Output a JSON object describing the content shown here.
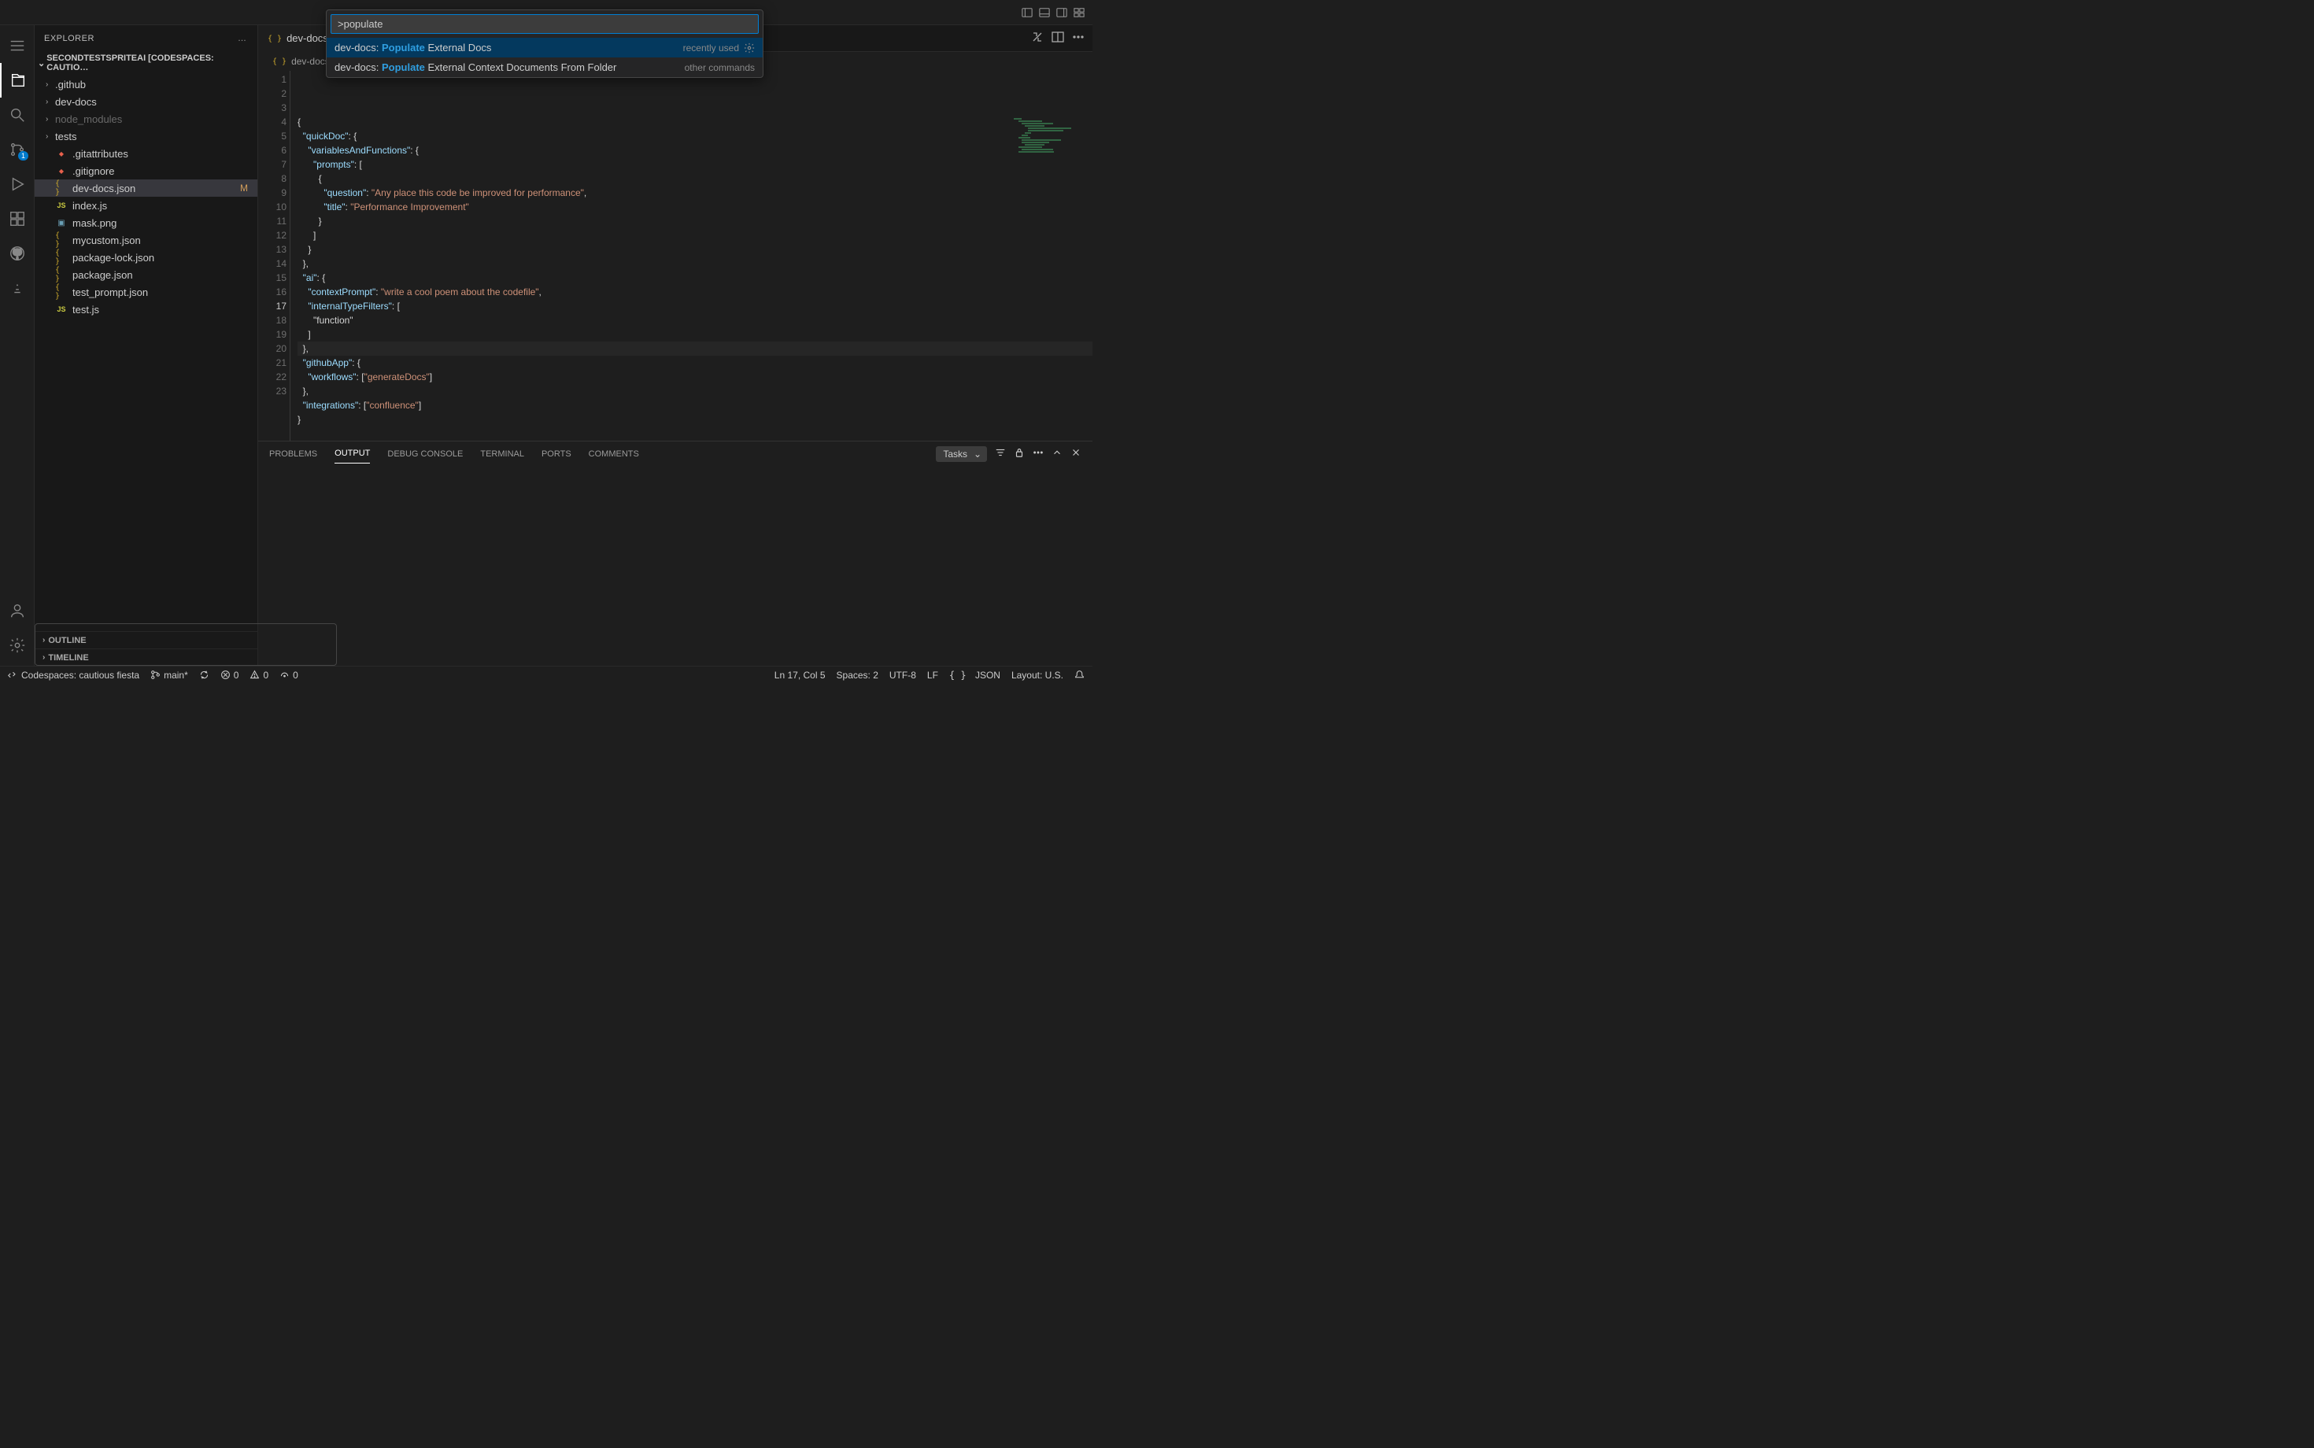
{
  "commandPalette": {
    "input": ">populate",
    "items": [
      {
        "prefix": "dev-docs: ",
        "highlight": "Populate",
        "suffix": " External Docs",
        "hint": "recently used",
        "gear": true
      },
      {
        "prefix": "dev-docs: ",
        "highlight": "Populate",
        "suffix": " External Context Documents From Folder",
        "hint": "other commands",
        "gear": false
      }
    ]
  },
  "sidebar": {
    "title": "EXPLORER",
    "actions": "…",
    "folderHeader": "SECONDTESTSPRITEAI [CODESPACES: CAUTIO…",
    "tree": [
      {
        "type": "folder",
        "label": ".github",
        "dim": false
      },
      {
        "type": "folder",
        "label": "dev-docs",
        "dim": false
      },
      {
        "type": "folder",
        "label": "node_modules",
        "dim": true
      },
      {
        "type": "folder",
        "label": "tests",
        "dim": false
      },
      {
        "type": "file",
        "icon": "git",
        "label": ".gitattributes"
      },
      {
        "type": "file",
        "icon": "git",
        "label": ".gitignore"
      },
      {
        "type": "file",
        "icon": "json",
        "label": "dev-docs.json",
        "selected": true,
        "badge": "M"
      },
      {
        "type": "file",
        "icon": "js",
        "label": "index.js"
      },
      {
        "type": "file",
        "icon": "img",
        "label": "mask.png"
      },
      {
        "type": "file",
        "icon": "json",
        "label": "mycustom.json"
      },
      {
        "type": "file",
        "icon": "json",
        "label": "package-lock.json"
      },
      {
        "type": "file",
        "icon": "json",
        "label": "package.json"
      },
      {
        "type": "file",
        "icon": "json",
        "label": "test_prompt.json"
      },
      {
        "type": "file",
        "icon": "js",
        "label": "test.js"
      }
    ],
    "outline": "OUTLINE",
    "timeline": "TIMELINE"
  },
  "activitybar": {
    "scmBadge": "1"
  },
  "tabs": {
    "tab1": "dev-docs.json",
    "breadcrumb": "dev-docs"
  },
  "editor": {
    "lines": [
      "{",
      "  \"quickDoc\": {",
      "    \"variablesAndFunctions\": {",
      "      \"prompts\": [",
      "        {",
      "          \"question\": \"Any place this code be improved for performance\",",
      "          \"title\": \"Performance Improvement\"",
      "        }",
      "      ]",
      "    }",
      "  },",
      "  \"ai\": {",
      "    \"contextPrompt\": \"write a cool poem about the codefile\",",
      "    \"internalTypeFilters\": [",
      "      \"function\"",
      "    ]",
      "  },",
      "  \"githubApp\": {",
      "    \"workflows\": [\"generateDocs\"]",
      "  },",
      "  \"integrations\": [\"confluence\"]",
      "}",
      ""
    ],
    "currentLine": 17
  },
  "panel": {
    "tabs": [
      "PROBLEMS",
      "OUTPUT",
      "DEBUG CONSOLE",
      "TERMINAL",
      "PORTS",
      "COMMENTS"
    ],
    "active": 1,
    "select": "Tasks"
  },
  "statusbar": {
    "codespace": "Codespaces: cautious fiesta",
    "branch": "main*",
    "sync": "",
    "errors": "0",
    "warnings": "0",
    "ports": "0",
    "lncol": "Ln 17, Col 5",
    "spaces": "Spaces: 2",
    "encoding": "UTF-8",
    "eol": "LF",
    "lang": "JSON",
    "langicon": "{ }",
    "layout": "Layout: U.S."
  }
}
